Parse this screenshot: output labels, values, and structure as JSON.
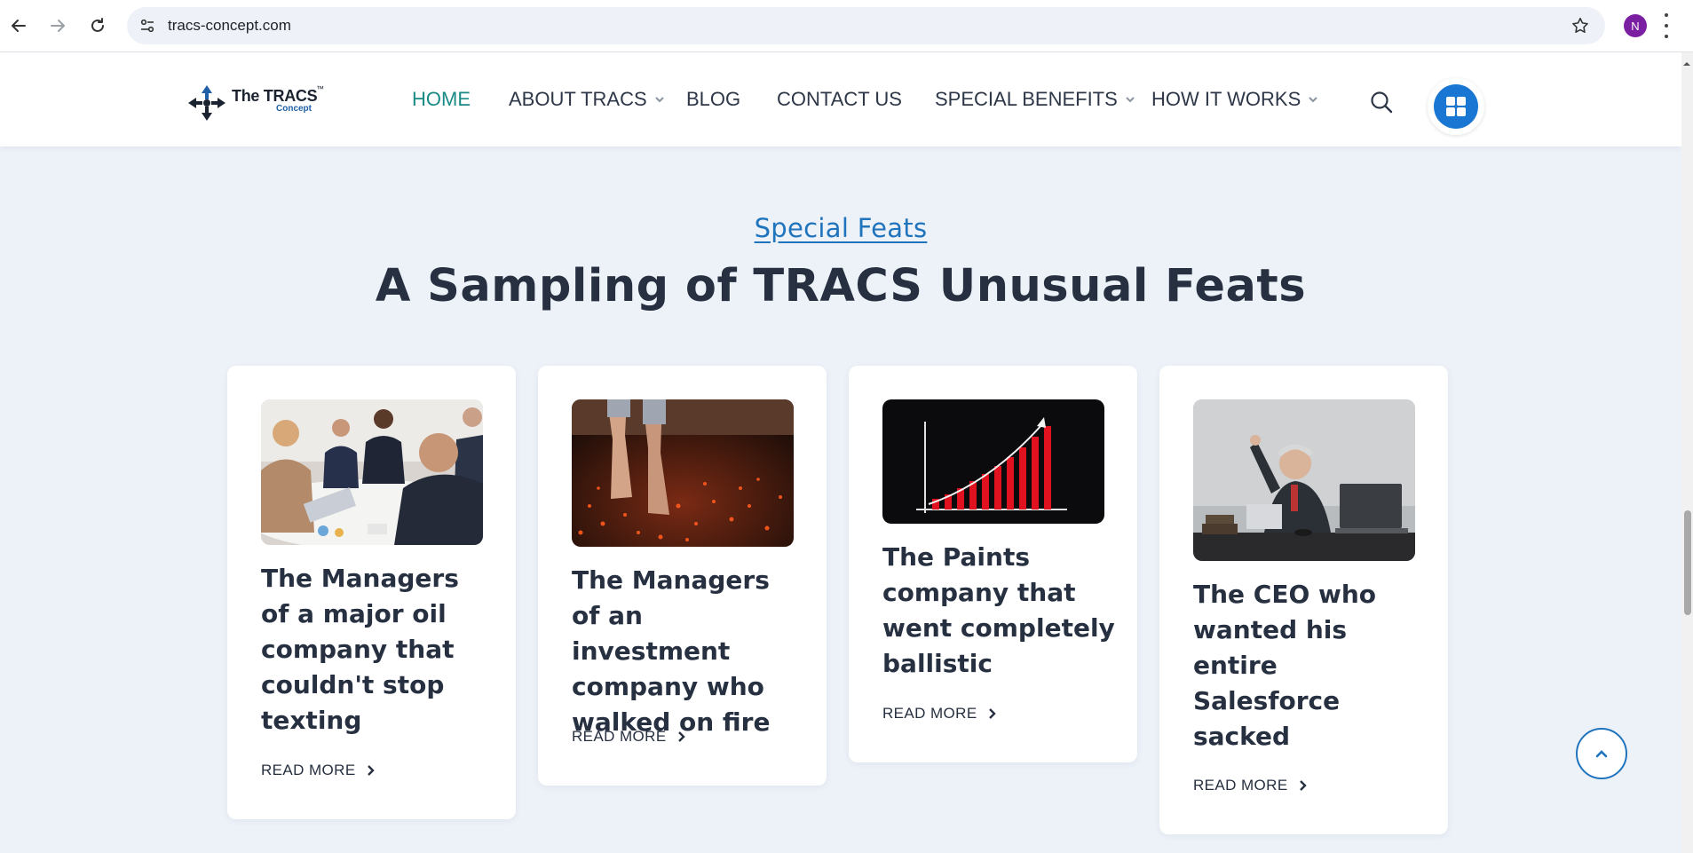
{
  "browser": {
    "url": "tracs-concept.com",
    "profile_initial": "N"
  },
  "logo": {
    "name": "The TRACS",
    "tm": "™",
    "sub": "Concept"
  },
  "nav": {
    "items": [
      {
        "label": "HOME",
        "active": true
      },
      {
        "label": "ABOUT TRACS",
        "dropdown": true
      },
      {
        "label": "BLOG"
      },
      {
        "label": "CONTACT US"
      },
      {
        "label": "SPECIAL BENEFITS",
        "dropdown": true
      },
      {
        "label": "HOW IT WORKS",
        "dropdown": true
      }
    ]
  },
  "section": {
    "eyebrow": "Special Feats",
    "title": "A Sampling of TRACS Unusual Feats"
  },
  "cards": [
    {
      "image": "business-meeting-photo",
      "title_lines": [
        "The Managers",
        "of a major oil",
        "company that",
        "couldn't stop",
        "texting"
      ],
      "read_more": "READ MORE"
    },
    {
      "image": "firewalk-photo",
      "title_lines": [
        "The Managers",
        "of an investment",
        "company who",
        "walked on fire"
      ],
      "read_more": "READ MORE"
    },
    {
      "image": "rising-bar-chart-graphic",
      "title_lines": [
        "The Paints",
        "company that",
        "went completely",
        "ballistic"
      ],
      "read_more": "READ MORE"
    },
    {
      "image": "angry-executive-photo",
      "title_lines": [
        "The CEO who",
        "wanted his",
        "entire",
        "Salesforce",
        "sacked"
      ],
      "read_more": "READ MORE"
    }
  ],
  "colors": {
    "accent": "#1f74bd",
    "active_nav": "#1a8a86",
    "page_bg": "#edf1f8",
    "heading": "#263040"
  }
}
